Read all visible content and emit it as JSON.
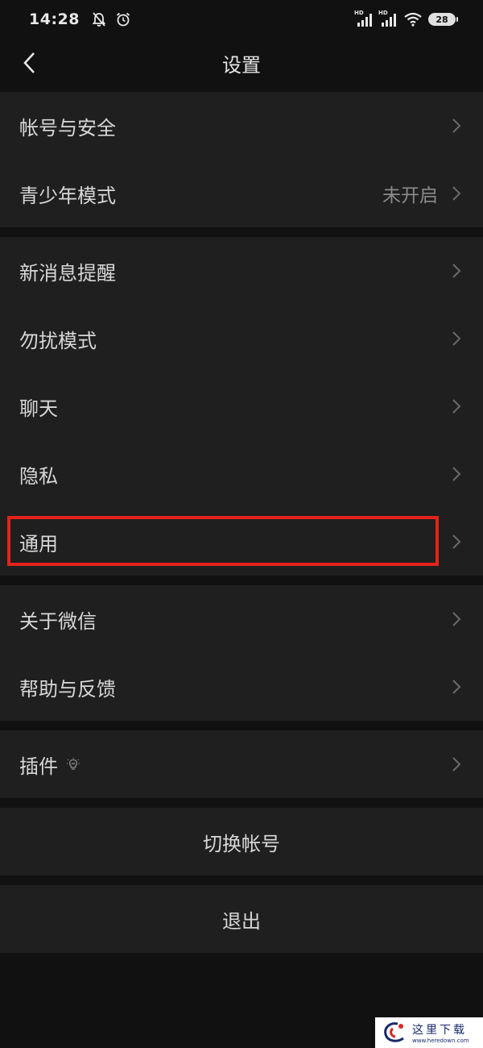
{
  "status_bar": {
    "time": "14:28",
    "signal_label_1": "HD",
    "signal_label_2": "HD",
    "battery": "28"
  },
  "nav": {
    "title": "设置"
  },
  "groups": [
    {
      "items": [
        {
          "label": "帐号与安全"
        },
        {
          "label": "青少年模式",
          "value": "未开启"
        }
      ]
    },
    {
      "items": [
        {
          "label": "新消息提醒"
        },
        {
          "label": "勿扰模式"
        },
        {
          "label": "聊天"
        },
        {
          "label": "隐私"
        },
        {
          "label": "通用"
        }
      ]
    },
    {
      "items": [
        {
          "label": "关于微信"
        },
        {
          "label": "帮助与反馈"
        }
      ]
    },
    {
      "items": [
        {
          "label": "插件"
        }
      ]
    }
  ],
  "actions": {
    "switch_account": "切换帐号",
    "logout": "退出"
  },
  "watermark": {
    "title": "这里下载",
    "url": "www.heredown.com"
  },
  "colors": {
    "background": "#111111",
    "cell": "#1f1f1f",
    "text": "#d8d8d8",
    "secondary_text": "#8a8a8a",
    "highlight": "#e3231a"
  }
}
